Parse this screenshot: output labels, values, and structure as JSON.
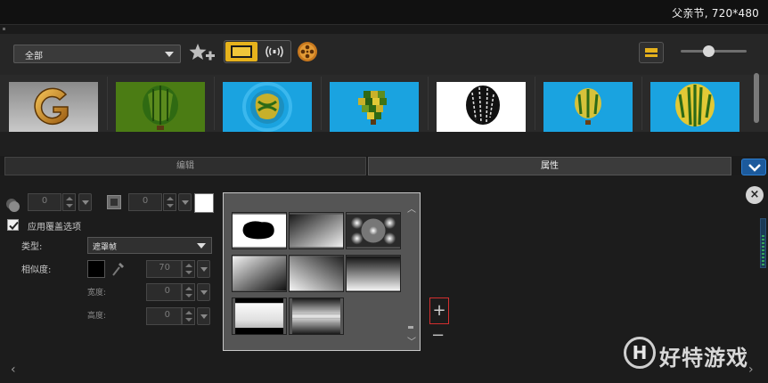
{
  "titlebar": {
    "project_info": "父亲节, 720*480"
  },
  "library": {
    "filter": "全部",
    "thumbnails": [
      "gold-g",
      "balloon-green",
      "balloon-ripple",
      "balloon-mosaic",
      "balloon-bw",
      "balloon-blue-small",
      "balloon-blue-large"
    ]
  },
  "tabs": {
    "edit": "编辑",
    "properties": "属性"
  },
  "props": {
    "shadow_value": "0",
    "border_value": "0",
    "overlay_label": "应用覆盖选项",
    "type_label": "类型:",
    "type_value": "遮罩帧",
    "similarity_label": "相似度:",
    "similarity_value": "70",
    "width_label": "宽度:",
    "width_value": "0",
    "height_label": "高度:",
    "height_value": "0"
  },
  "watermark": {
    "glyph": "H",
    "text": "好特游戏"
  },
  "colors": {
    "accent": "#e6b21c",
    "panel": "#1c1c1c",
    "sky": "#1aa3e0"
  }
}
